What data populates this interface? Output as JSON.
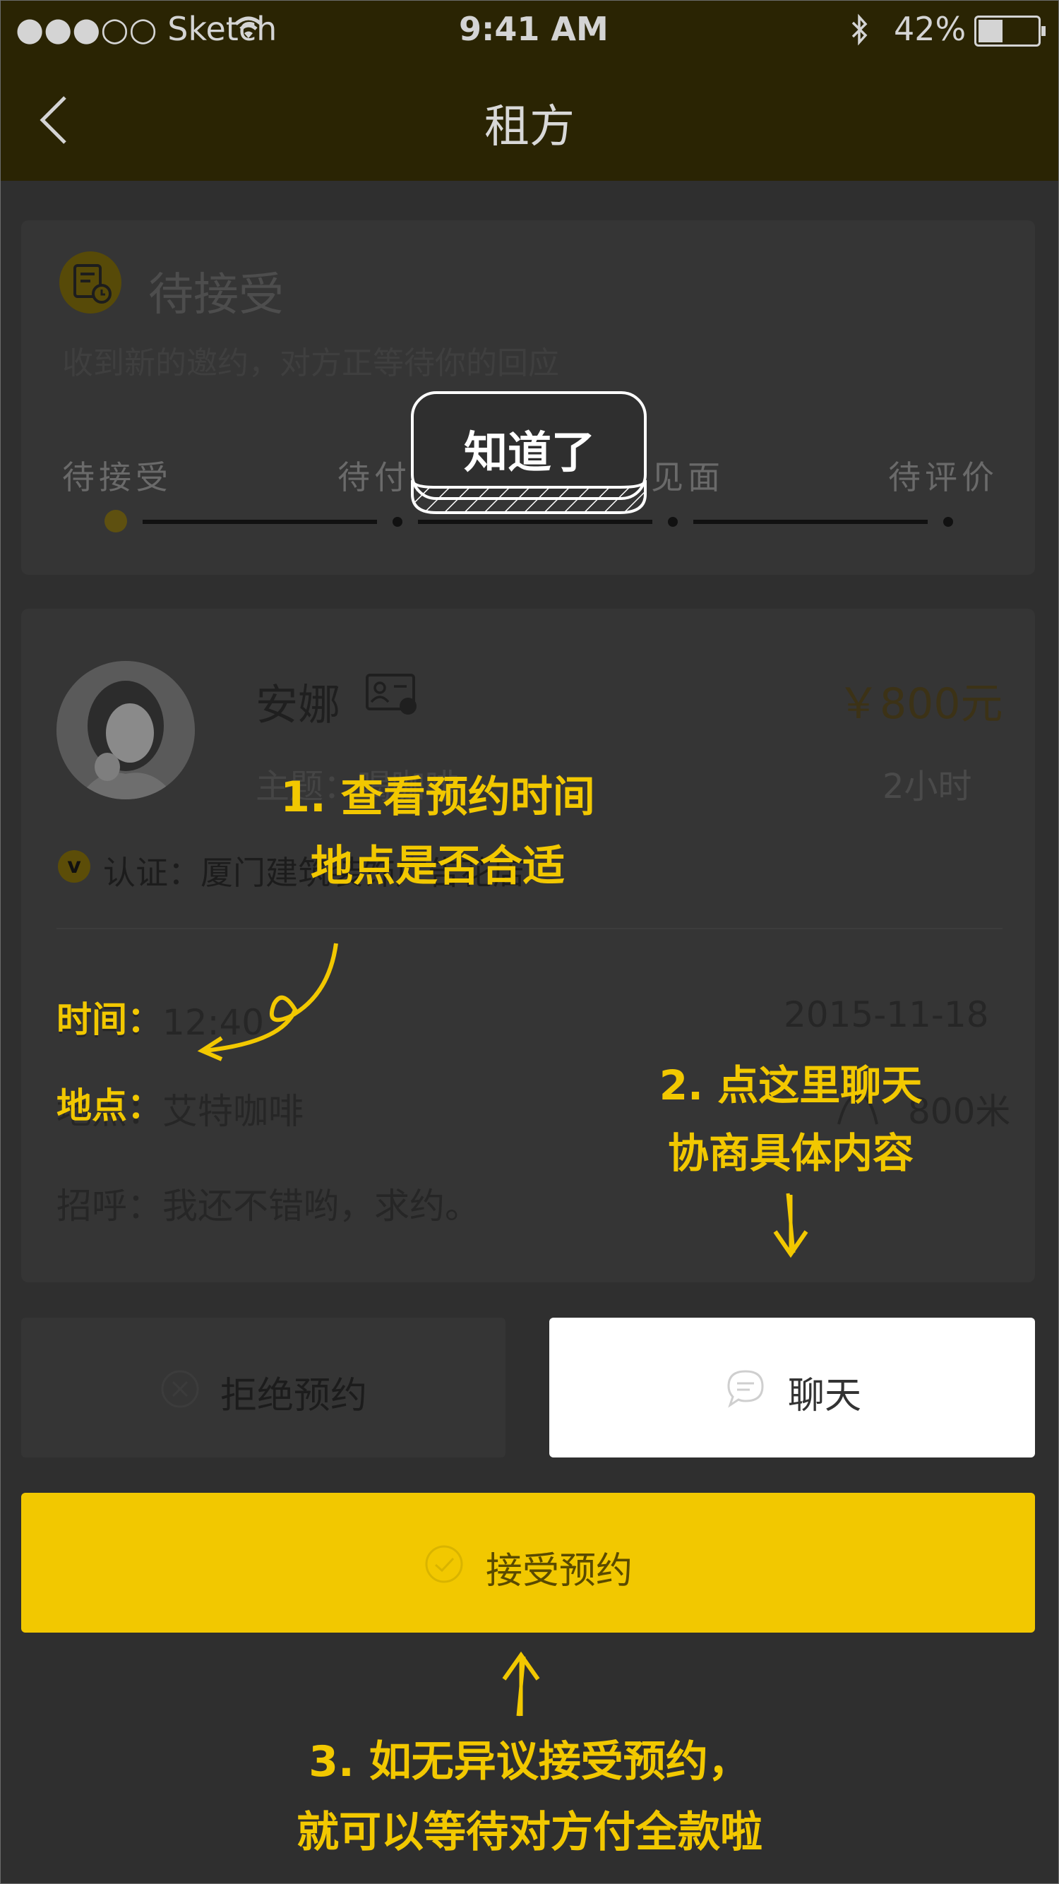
{
  "status_bar": {
    "carrier": "●●●○○ Sketch",
    "time": "9:41 AM",
    "battery": "42%"
  },
  "nav": {
    "title": "租方"
  },
  "status_card": {
    "heading": "待接受",
    "subtitle": "收到新的邀约，对方正等待你的回应",
    "steps": [
      "待接受",
      "待付款",
      "待见面",
      "待评价"
    ]
  },
  "know_button": "知道了",
  "detail": {
    "name": "安娜",
    "price": "￥800元",
    "topic": "主题：喝咖啡",
    "duration": "2小时",
    "cert": "认证：厦门建筑装饰广告花店",
    "time_value": "时间：12:40",
    "date": "2015-11-18",
    "place_value": "地点：艾特咖啡",
    "distance": "800米",
    "greeting": "招呼：我还不错哟，求约。"
  },
  "buttons": {
    "reject": "拒绝预约",
    "chat": "聊天",
    "accept": "接受预约"
  },
  "tips": {
    "tip1_line1": "1. 查看预约时间",
    "tip1_line2": "地点是否合适",
    "time_label": "时间：",
    "place_label": "地点：",
    "tip2_line1": "2. 点这里聊天",
    "tip2_line2": "协商具体内容",
    "tip3_line1": "3. 如无异议接受预约，",
    "tip3_line2": "就可以等待对方付全款啦"
  },
  "colors": {
    "accent": "#f2c800",
    "overlay_bg": "#2f2f2f",
    "card": "#353535"
  }
}
